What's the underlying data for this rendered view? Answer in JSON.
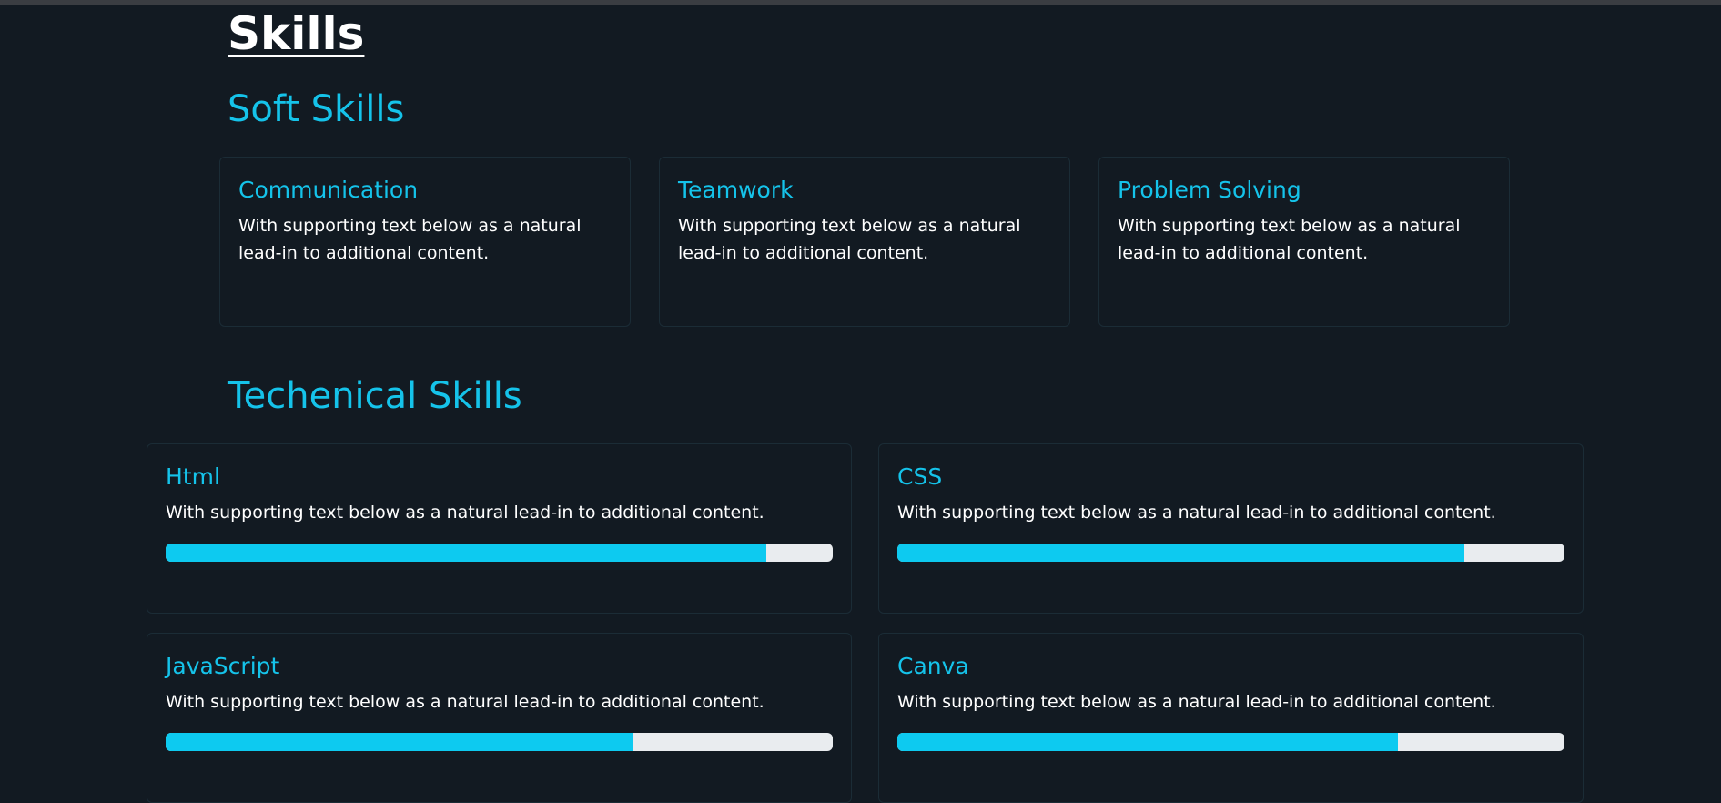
{
  "page": {
    "title": "Skills"
  },
  "soft_skills": {
    "heading": "Soft Skills",
    "cards": [
      {
        "title": "Communication",
        "text": "With supporting text below as a natural lead-in to additional content."
      },
      {
        "title": "Teamwork",
        "text": "With supporting text below as a natural lead-in to additional content."
      },
      {
        "title": "Problem Solving",
        "text": "With supporting text below as a natural lead-in to additional content."
      }
    ]
  },
  "technical_skills": {
    "heading": "Techenical Skills",
    "cards": [
      {
        "title": "Html",
        "text": "With supporting text below as a natural lead-in to additional content.",
        "progress_percent": 90
      },
      {
        "title": "CSS",
        "text": "With supporting text below as a natural lead-in to additional content.",
        "progress_percent": 85
      },
      {
        "title": "JavaScript",
        "text": "With supporting text below as a natural lead-in to additional content.",
        "progress_percent": 70
      },
      {
        "title": "Canva",
        "text": "With supporting text below as a natural lead-in to additional content.",
        "progress_percent": 75
      }
    ]
  },
  "colors": {
    "background": "#121a22",
    "accent": "#15c3ea",
    "progress_fill": "#0dcaf0",
    "progress_track": "#e9ecef"
  }
}
